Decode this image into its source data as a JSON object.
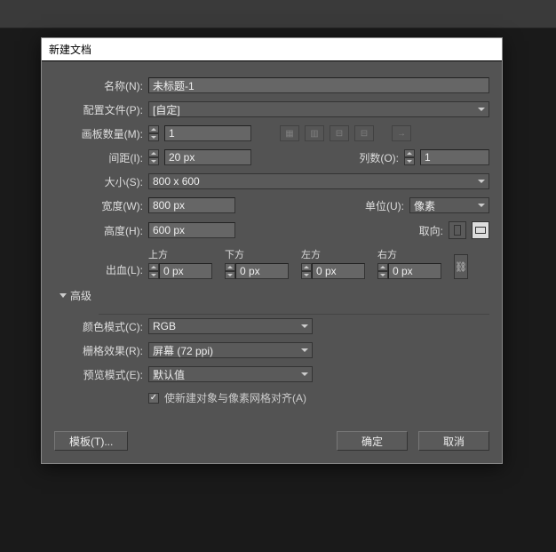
{
  "dialog": {
    "title": "新建文档",
    "name_label": "名称(N):",
    "name_value": "未标题-1",
    "profile_label": "配置文件(P):",
    "profile_value": "[自定]",
    "artboard_count_label": "画板数量(M):",
    "artboard_count_value": "1",
    "spacing_label": "间距(I):",
    "spacing_value": "20 px",
    "columns_label": "列数(O):",
    "columns_value": "1",
    "size_label": "大小(S):",
    "size_value": "800 x 600",
    "width_label": "宽度(W):",
    "width_value": "800 px",
    "units_label": "单位(U):",
    "units_value": "像素",
    "height_label": "高度(H):",
    "height_value": "600 px",
    "orientation_label": "取向:",
    "bleed_label": "出血(L):",
    "bleed": {
      "top_label": "上方",
      "bottom_label": "下方",
      "left_label": "左方",
      "right_label": "右方",
      "top": "0 px",
      "bottom": "0 px",
      "left": "0 px",
      "right": "0 px"
    },
    "advanced_label": "高级",
    "color_mode_label": "颜色模式(C):",
    "color_mode_value": "RGB",
    "raster_label": "栅格效果(R):",
    "raster_value": "屏幕 (72 ppi)",
    "preview_label": "预览模式(E):",
    "preview_value": "默认值",
    "align_label": "使新建对象与像素网格对齐(A)",
    "template_btn": "模板(T)...",
    "ok_btn": "确定",
    "cancel_btn": "取消"
  }
}
